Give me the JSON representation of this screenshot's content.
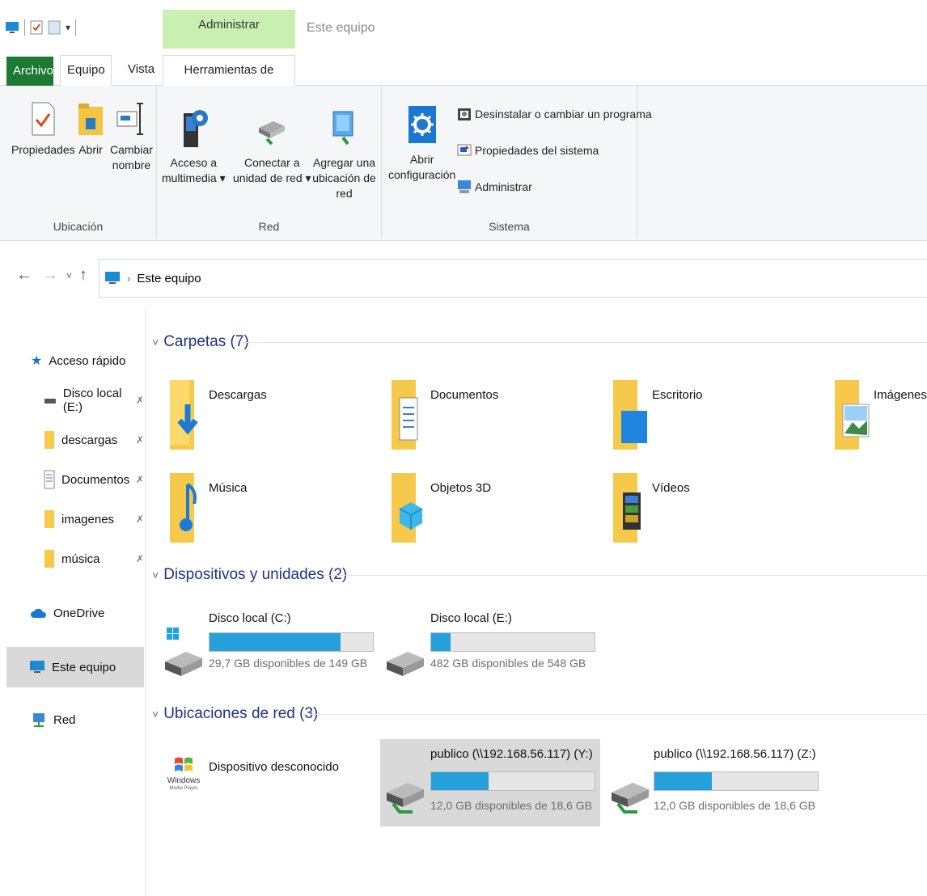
{
  "window": {
    "title": "Este equipo",
    "context_tab": "Administrar"
  },
  "ribbon_tabs": [
    "Archivo",
    "Equipo",
    "Vista",
    "Herramientas de unidad"
  ],
  "ribbon": {
    "ubicacion": {
      "label": "Ubicación",
      "buttons": [
        {
          "line1": "Propiedades",
          "line2": "",
          "icon": "properties-icon"
        },
        {
          "line1": "Abrir",
          "line2": "",
          "icon": "open-icon"
        },
        {
          "line1": "Cambiar",
          "line2": "nombre",
          "icon": "rename-icon"
        }
      ]
    },
    "red": {
      "label": "Red",
      "buttons": [
        {
          "line1": "Acceso a",
          "line2": "multimedia ▾",
          "icon": "media-icon"
        },
        {
          "line1": "Conectar a",
          "line2": "unidad de red ▾",
          "icon": "network-drive-icon"
        },
        {
          "line1": "Agregar una",
          "line2": "ubicación de red",
          "icon": "network-location-icon"
        }
      ]
    },
    "sistema": {
      "label": "Sistema",
      "open_config": {
        "line1": "Abrir",
        "line2": "configuración"
      },
      "small": [
        "Desinstalar o cambiar un programa",
        "Propiedades del sistema",
        "Administrar"
      ]
    }
  },
  "address": {
    "path": "Este equipo"
  },
  "sidebar": {
    "quick_access": "Acceso rápido",
    "pinned": [
      "Disco local (E:)",
      "descargas",
      "Documentos",
      "imagenes",
      "música"
    ],
    "onedrive": "OneDrive",
    "this_pc": "Este equipo",
    "network": "Red"
  },
  "sections": {
    "folders": {
      "title": "Carpetas (7)",
      "items": [
        "Descargas",
        "Documentos",
        "Escritorio",
        "Imágenes",
        "Música",
        "Objetos 3D",
        "Vídeos"
      ]
    },
    "devices": {
      "title": "Dispositivos y unidades (2)",
      "items": [
        {
          "name": "Disco local (C:)",
          "free": "29,7 GB disponibles de 149 GB",
          "used_fraction": 0.8
        },
        {
          "name": "Disco local (E:)",
          "free": "482 GB disponibles de 548 GB",
          "used_fraction": 0.12
        }
      ]
    },
    "network": {
      "title": "Ubicaciones de red (3)",
      "unknown": {
        "name": "Dispositivo desconocido",
        "logo_text": "Windows",
        "logo_sub": "Media Player"
      },
      "items": [
        {
          "name": "publico (\\\\192.168.56.117) (Y:)",
          "free": "12,0 GB disponibles de 18,6 GB",
          "used_fraction": 0.35
        },
        {
          "name": "publico (\\\\192.168.56.117) (Z:)",
          "free": "12,0 GB disponibles de 18,6 GB",
          "used_fraction": 0.35
        }
      ]
    }
  },
  "colors": {
    "accent": "#26a0da",
    "section_title": "#1e3287",
    "archivo_tab": "#1d7a33",
    "context_tab": "#c9f0b0"
  }
}
